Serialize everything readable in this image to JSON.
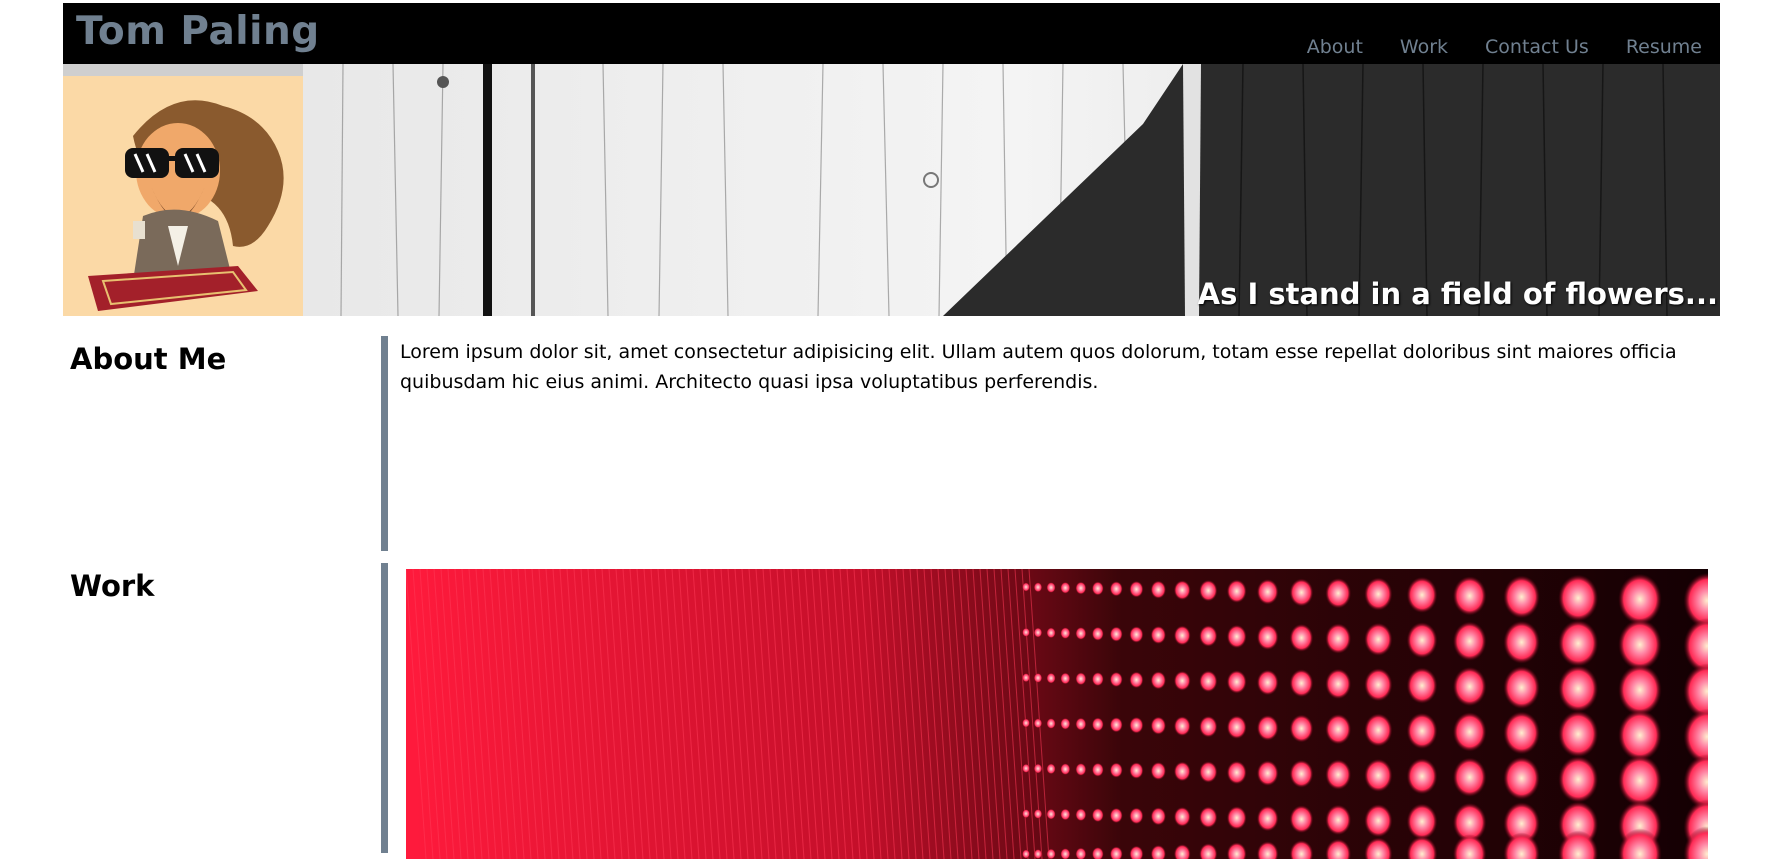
{
  "header": {
    "site_title": "Tom Paling",
    "nav": [
      "About",
      "Work",
      "Contact Us",
      "Resume"
    ]
  },
  "banner": {
    "caption": "As I stand in a field of flowers..."
  },
  "about": {
    "title": "About Me",
    "text": "Lorem ipsum dolor sit, amet consectetur adipisicing elit. Ullam autem quos dolorum, totam esse repellat doloribus sint maiores officia quibusdam hic eius animi. Architecto quasi ipsa voluptatibus perferendis."
  },
  "work": {
    "title": "Work"
  },
  "colors": {
    "accent": "#708090",
    "header_bg": "#000000",
    "led_red": "#ff1a3c"
  }
}
